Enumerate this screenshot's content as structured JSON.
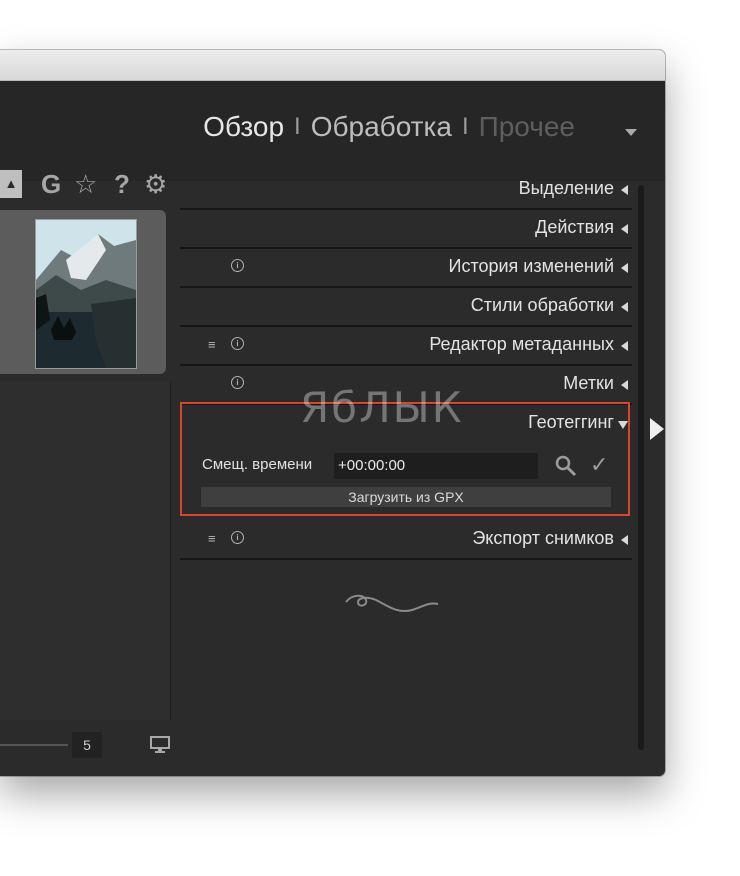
{
  "header": {
    "modules": [
      {
        "label": "Обзор",
        "state": "active"
      },
      {
        "label": "Обработка",
        "state": "normal"
      },
      {
        "label": "Прочее",
        "state": "dim"
      }
    ],
    "separator": "I"
  },
  "left_toolbar": {
    "items": [
      {
        "icon": "triangle-up-icon"
      },
      {
        "icon": "g-icon",
        "label": "G"
      },
      {
        "icon": "star-icon"
      },
      {
        "icon": "question-icon",
        "label": "?"
      },
      {
        "icon": "gear-icon"
      }
    ]
  },
  "filmstrip": {
    "page_value": "5"
  },
  "panels": [
    {
      "label": "Выделение",
      "icons": [],
      "expanded": false
    },
    {
      "label": "Действия",
      "icons": [],
      "expanded": false
    },
    {
      "label": "История изменений",
      "icons": [
        "info-icon"
      ],
      "expanded": false
    },
    {
      "label": "Стили обработки",
      "icons": [],
      "expanded": false
    },
    {
      "label": "Редактор метаданных",
      "icons": [
        "menu-icon",
        "info-icon"
      ],
      "expanded": false
    },
    {
      "label": "Метки",
      "icons": [
        "info-icon"
      ],
      "expanded": false
    },
    {
      "label": "Геотеггинг",
      "icons": [],
      "expanded": true
    },
    {
      "label": "Экспорт снимков",
      "icons": [
        "menu-icon",
        "info-icon"
      ],
      "expanded": false
    }
  ],
  "geotagging": {
    "time_offset_label": "Смещ. времени",
    "time_offset_value": "+00:00:00",
    "load_gpx_button": "Загрузить из GPX"
  },
  "watermark": "ЯбЛЫК",
  "colors": {
    "background": "#2b2b2b",
    "highlight_border": "#d9452f",
    "text": "#e3e3e3"
  }
}
